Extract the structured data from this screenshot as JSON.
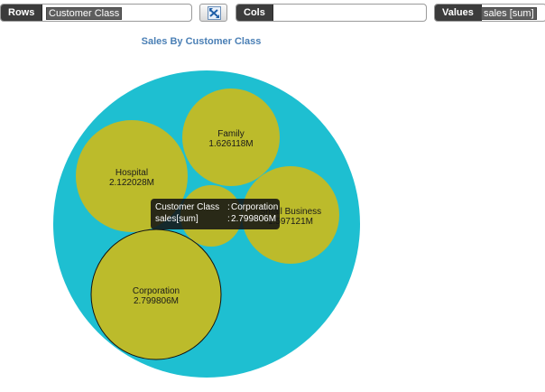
{
  "toolbar": {
    "rows": {
      "label": "Rows",
      "value": "Customer Class"
    },
    "swap": {
      "icon": "swap-axes-icon"
    },
    "cols": {
      "label": "Cols",
      "value": ""
    },
    "values": {
      "label": "Values",
      "value": "sales [sum]"
    }
  },
  "chart_data": {
    "type": "bubble",
    "title": "Sales By Customer Class",
    "series_field": "Customer Class",
    "measure": "sales[sum]",
    "items": [
      {
        "category": "Corporation",
        "value": 2.799806,
        "label_value": "2.799806M",
        "highlighted": true
      },
      {
        "category": "Hospital",
        "value": 2.122028,
        "label_value": "2.122028M"
      },
      {
        "category": "Family",
        "value": 1.626118,
        "label_value": "1.626118M"
      },
      {
        "category": "Small Business",
        "label_value": "1.597121M",
        "value": 1.597121
      },
      {
        "category": "",
        "value": null,
        "label_value": ""
      }
    ],
    "colors": {
      "outer": "#1ebfd1",
      "bubble": "#bcbb2b",
      "highlight_stroke": "#111111"
    }
  },
  "tooltip": {
    "key_line": "Customer Class",
    "value_line_key": "sales[sum]",
    "separator": ":",
    "category": "Corporation",
    "value": "2.799806M"
  }
}
